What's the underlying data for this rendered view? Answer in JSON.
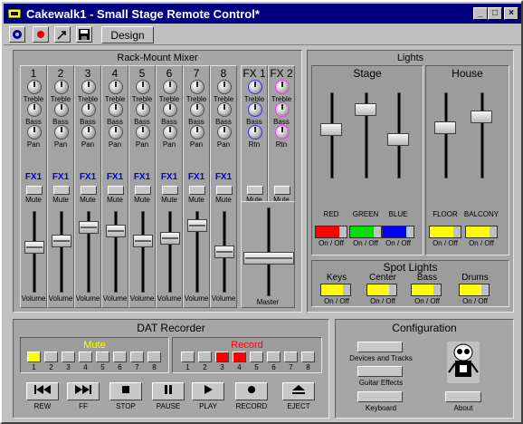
{
  "window": {
    "title": "Cakewalk1 - Small Stage Remote Control*",
    "minimize": "_",
    "maximize": "□",
    "close": "×"
  },
  "toolbar": {
    "design_label": "Design",
    "icons": [
      "settings-icon",
      "record-icon",
      "cursor-icon",
      "save-icon"
    ]
  },
  "mixer": {
    "title": "Rack-Mount Mixer",
    "treble_label": "Treble",
    "bass_label": "Bass",
    "pan_label": "Pan",
    "fx_label": "FX1",
    "mute_label": "Mute",
    "volume_label": "Volume",
    "rtn_label": "Rtn",
    "master_label": "Master",
    "channels": [
      {
        "name": "1"
      },
      {
        "name": "2"
      },
      {
        "name": "3"
      },
      {
        "name": "4"
      },
      {
        "name": "5"
      },
      {
        "name": "6"
      },
      {
        "name": "7"
      },
      {
        "name": "8"
      }
    ],
    "fx_channels": [
      {
        "name": "FX 1",
        "color": "#3030ff"
      },
      {
        "name": "FX 2",
        "color": "#ff30ff"
      }
    ],
    "volume_levels": [
      0.57,
      0.66,
      0.86,
      0.8,
      0.66,
      0.7,
      0.88,
      0.5
    ],
    "master_level": 0.42
  },
  "lights": {
    "title": "Lights",
    "stage_label": "Stage",
    "house_label": "House",
    "stage": [
      {
        "label": "RED",
        "color": "#ff0000",
        "level": 0.58
      },
      {
        "label": "GREEN",
        "color": "#00e000",
        "level": 0.85
      },
      {
        "label": "BLUE",
        "color": "#0000ff",
        "level": 0.45
      }
    ],
    "house": [
      {
        "label": "FLOOR",
        "color": "#ffff00",
        "level": 0.6
      },
      {
        "label": "BALCONY",
        "color": "#ffff00",
        "level": 0.75
      }
    ],
    "onoff_label": "On / Off",
    "spot_title": "Spot Lights",
    "spots": [
      {
        "label": "Keys"
      },
      {
        "label": "Center"
      },
      {
        "label": "Bass"
      },
      {
        "label": "Drums"
      }
    ]
  },
  "dat": {
    "title": "DAT Recorder",
    "mute_label": "Mute",
    "record_label": "Record",
    "mute_numbers": [
      "1",
      "2",
      "3",
      "4",
      "5",
      "6",
      "7",
      "8"
    ],
    "record_numbers": [
      "1",
      "2",
      "3",
      "4",
      "5",
      "6",
      "7",
      "8"
    ],
    "mute_active": [
      1
    ],
    "record_active": [
      3,
      4
    ],
    "transport": [
      {
        "label": "REW",
        "icon": "rewind-icon"
      },
      {
        "label": "FF",
        "icon": "fast-forward-icon"
      },
      {
        "label": "STOP",
        "icon": "stop-icon"
      },
      {
        "label": "PAUSE",
        "icon": "pause-icon"
      },
      {
        "label": "PLAY",
        "icon": "play-icon"
      },
      {
        "label": "RECORD",
        "icon": "record-icon"
      },
      {
        "label": "EJECT",
        "icon": "eject-icon"
      }
    ]
  },
  "config": {
    "title": "Configuration",
    "buttons": [
      {
        "label": "Devices and Tracks"
      },
      {
        "label": "Guitar Effects"
      },
      {
        "label": "Keyboard"
      }
    ],
    "about_label": "About"
  }
}
